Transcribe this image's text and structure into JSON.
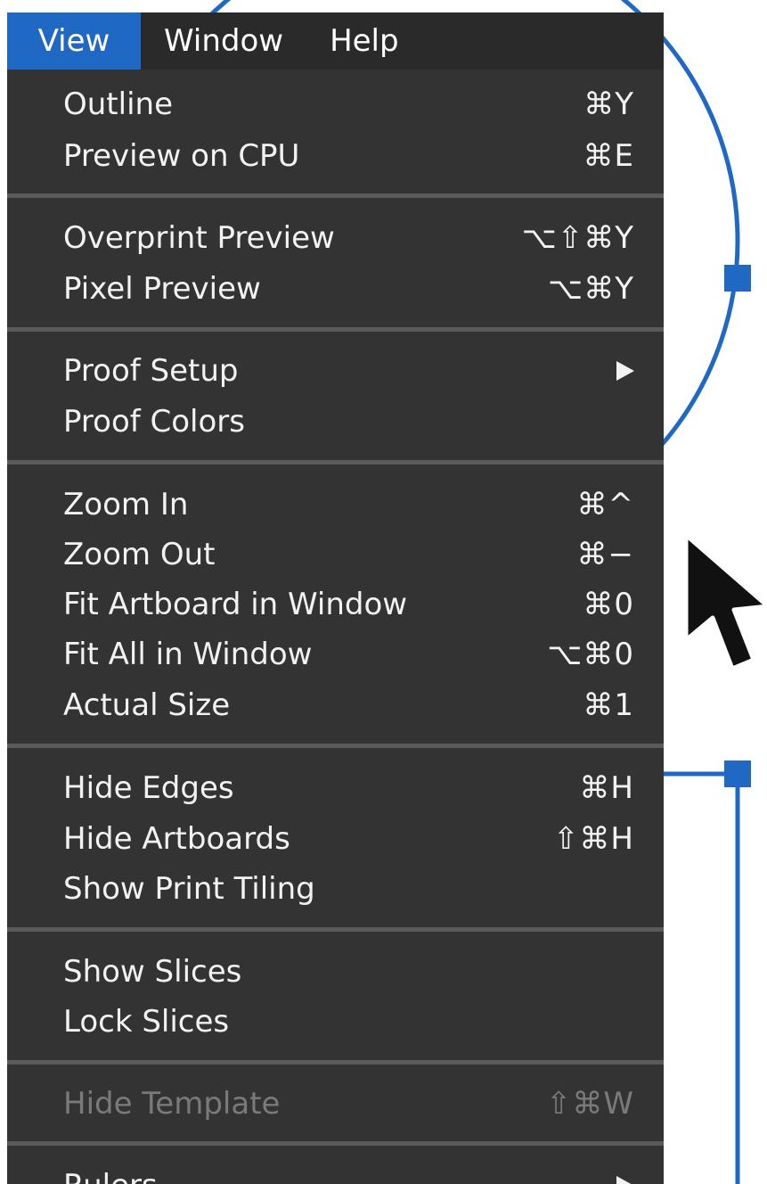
{
  "menubar": {
    "items": [
      {
        "label": "View"
      },
      {
        "label": "Window"
      },
      {
        "label": "Help"
      }
    ]
  },
  "menu": {
    "items": [
      {
        "label": "Outline",
        "shortcut": "⌘Y"
      },
      {
        "label": "Preview on CPU",
        "shortcut": "⌘E"
      },
      {
        "label": "Overprint Preview",
        "shortcut": "⌥⇧⌘Y"
      },
      {
        "label": "Pixel Preview",
        "shortcut": "⌥⌘Y"
      },
      {
        "label": "Proof Setup",
        "shortcut": ""
      },
      {
        "label": "Proof Colors",
        "shortcut": ""
      },
      {
        "label": "Zoom In",
        "shortcut": "⌘^"
      },
      {
        "label": "Zoom Out",
        "shortcut": "⌘−"
      },
      {
        "label": "Fit Artboard in Window",
        "shortcut": "⌘0"
      },
      {
        "label": "Fit All in Window",
        "shortcut": "⌥⌘0"
      },
      {
        "label": "Actual Size",
        "shortcut": "⌘1"
      },
      {
        "label": "Hide Edges",
        "shortcut": "⌘H"
      },
      {
        "label": "Hide Artboards",
        "shortcut": "⇧⌘H"
      },
      {
        "label": "Show Print Tiling",
        "shortcut": ""
      },
      {
        "label": "Show Slices",
        "shortcut": ""
      },
      {
        "label": "Lock Slices",
        "shortcut": ""
      },
      {
        "label": "Hide Template",
        "shortcut": "⇧⌘W"
      },
      {
        "label": "Rulers",
        "shortcut": ""
      }
    ]
  },
  "colors": {
    "menubar_bg": "#2a2a2a",
    "active_menu_bg": "#1f68c4",
    "menu_bg": "#333333",
    "separator": "#5a5a5a",
    "text": "#f2f2f2",
    "disabled_text": "#7a7a7a",
    "annotation_blue": "#1f68c4"
  },
  "icons": {
    "submenu": "chevron-right-icon",
    "pointer": "mouse-cursor-icon"
  }
}
